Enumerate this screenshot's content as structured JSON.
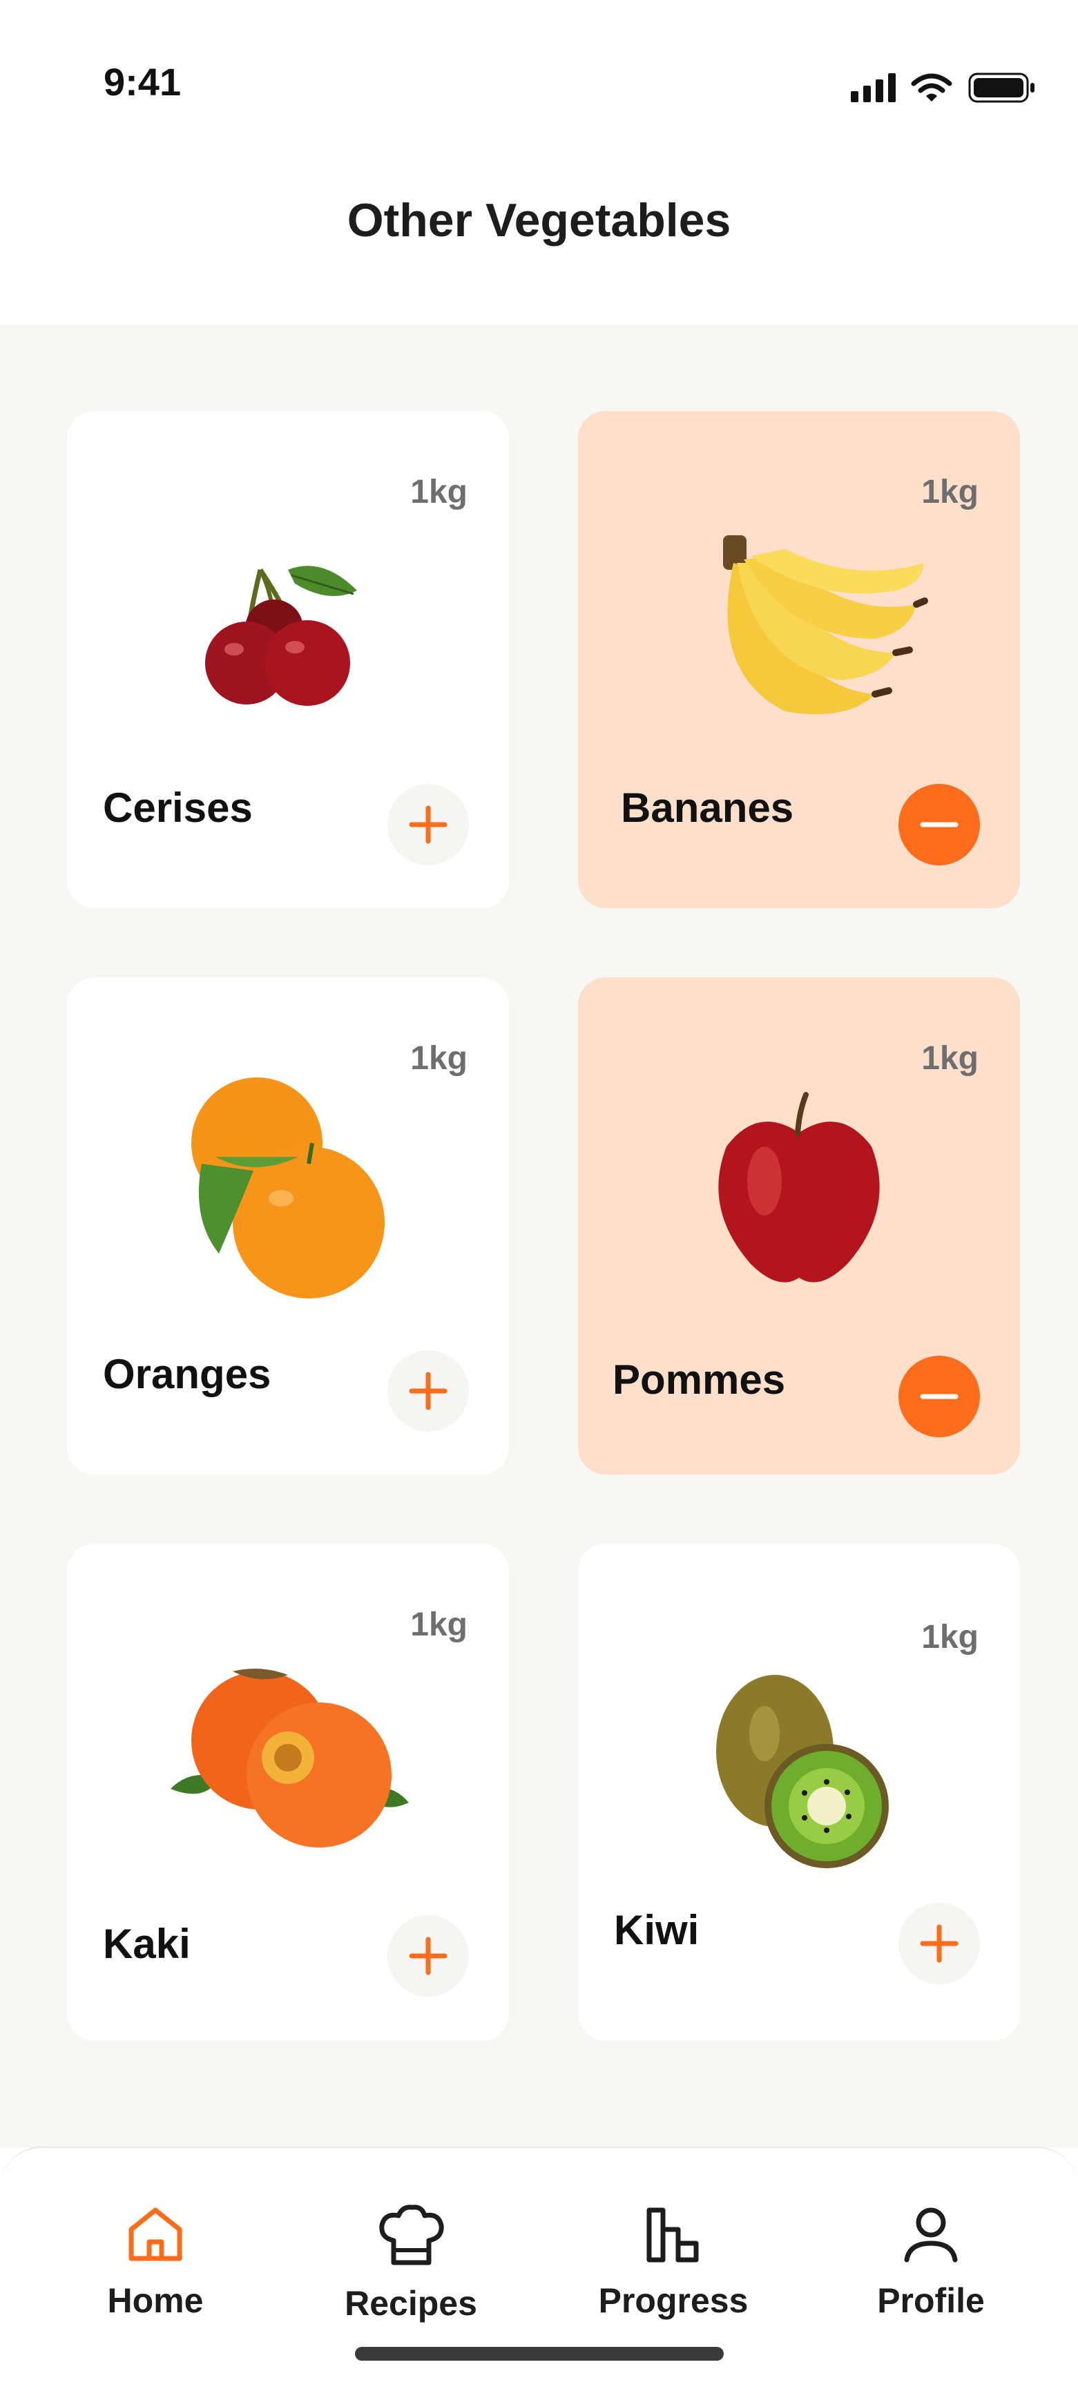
{
  "status_bar": {
    "time": "9:41"
  },
  "header": {
    "title": "Other Vegetables"
  },
  "colors": {
    "accent": "#fb6d1b",
    "selected_card": "#fddfcb",
    "background": "#f8f7f3"
  },
  "products": [
    {
      "name": "Cerises",
      "weight": "1kg",
      "selected": false,
      "icon": "cherries-image"
    },
    {
      "name": "Bananes",
      "weight": "1kg",
      "selected": true,
      "icon": "bananas-image"
    },
    {
      "name": "Oranges",
      "weight": "1kg",
      "selected": false,
      "icon": "oranges-image"
    },
    {
      "name": "Pommes",
      "weight": "1kg",
      "selected": true,
      "icon": "apple-image"
    },
    {
      "name": "Kaki",
      "weight": "1kg",
      "selected": false,
      "icon": "persimmon-image"
    },
    {
      "name": "Kiwi",
      "weight": "1kg",
      "selected": false,
      "icon": "kiwi-image"
    }
  ],
  "nav": {
    "items": [
      {
        "label": "Home",
        "icon": "home-icon",
        "active": true
      },
      {
        "label": "Recipes",
        "icon": "chef-hat-icon",
        "active": false
      },
      {
        "label": "Progress",
        "icon": "bar-chart-icon",
        "active": false
      },
      {
        "label": "Profile",
        "icon": "user-icon",
        "active": false
      }
    ]
  }
}
